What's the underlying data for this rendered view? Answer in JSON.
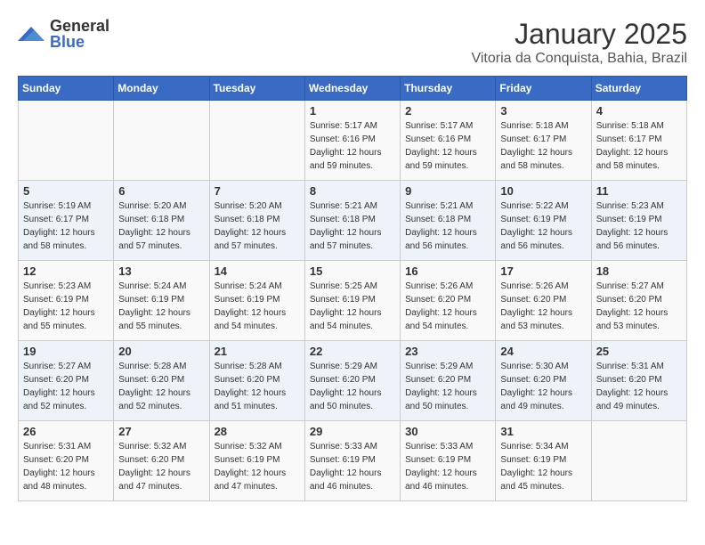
{
  "header": {
    "logo_general": "General",
    "logo_blue": "Blue",
    "title": "January 2025",
    "location": "Vitoria da Conquista, Bahia, Brazil"
  },
  "days_of_week": [
    "Sunday",
    "Monday",
    "Tuesday",
    "Wednesday",
    "Thursday",
    "Friday",
    "Saturday"
  ],
  "weeks": [
    [
      {
        "day": "",
        "info": ""
      },
      {
        "day": "",
        "info": ""
      },
      {
        "day": "",
        "info": ""
      },
      {
        "day": "1",
        "info": "Sunrise: 5:17 AM\nSunset: 6:16 PM\nDaylight: 12 hours\nand 59 minutes."
      },
      {
        "day": "2",
        "info": "Sunrise: 5:17 AM\nSunset: 6:16 PM\nDaylight: 12 hours\nand 59 minutes."
      },
      {
        "day": "3",
        "info": "Sunrise: 5:18 AM\nSunset: 6:17 PM\nDaylight: 12 hours\nand 58 minutes."
      },
      {
        "day": "4",
        "info": "Sunrise: 5:18 AM\nSunset: 6:17 PM\nDaylight: 12 hours\nand 58 minutes."
      }
    ],
    [
      {
        "day": "5",
        "info": "Sunrise: 5:19 AM\nSunset: 6:17 PM\nDaylight: 12 hours\nand 58 minutes."
      },
      {
        "day": "6",
        "info": "Sunrise: 5:20 AM\nSunset: 6:18 PM\nDaylight: 12 hours\nand 57 minutes."
      },
      {
        "day": "7",
        "info": "Sunrise: 5:20 AM\nSunset: 6:18 PM\nDaylight: 12 hours\nand 57 minutes."
      },
      {
        "day": "8",
        "info": "Sunrise: 5:21 AM\nSunset: 6:18 PM\nDaylight: 12 hours\nand 57 minutes."
      },
      {
        "day": "9",
        "info": "Sunrise: 5:21 AM\nSunset: 6:18 PM\nDaylight: 12 hours\nand 56 minutes."
      },
      {
        "day": "10",
        "info": "Sunrise: 5:22 AM\nSunset: 6:19 PM\nDaylight: 12 hours\nand 56 minutes."
      },
      {
        "day": "11",
        "info": "Sunrise: 5:23 AM\nSunset: 6:19 PM\nDaylight: 12 hours\nand 56 minutes."
      }
    ],
    [
      {
        "day": "12",
        "info": "Sunrise: 5:23 AM\nSunset: 6:19 PM\nDaylight: 12 hours\nand 55 minutes."
      },
      {
        "day": "13",
        "info": "Sunrise: 5:24 AM\nSunset: 6:19 PM\nDaylight: 12 hours\nand 55 minutes."
      },
      {
        "day": "14",
        "info": "Sunrise: 5:24 AM\nSunset: 6:19 PM\nDaylight: 12 hours\nand 54 minutes."
      },
      {
        "day": "15",
        "info": "Sunrise: 5:25 AM\nSunset: 6:19 PM\nDaylight: 12 hours\nand 54 minutes."
      },
      {
        "day": "16",
        "info": "Sunrise: 5:26 AM\nSunset: 6:20 PM\nDaylight: 12 hours\nand 54 minutes."
      },
      {
        "day": "17",
        "info": "Sunrise: 5:26 AM\nSunset: 6:20 PM\nDaylight: 12 hours\nand 53 minutes."
      },
      {
        "day": "18",
        "info": "Sunrise: 5:27 AM\nSunset: 6:20 PM\nDaylight: 12 hours\nand 53 minutes."
      }
    ],
    [
      {
        "day": "19",
        "info": "Sunrise: 5:27 AM\nSunset: 6:20 PM\nDaylight: 12 hours\nand 52 minutes."
      },
      {
        "day": "20",
        "info": "Sunrise: 5:28 AM\nSunset: 6:20 PM\nDaylight: 12 hours\nand 52 minutes."
      },
      {
        "day": "21",
        "info": "Sunrise: 5:28 AM\nSunset: 6:20 PM\nDaylight: 12 hours\nand 51 minutes."
      },
      {
        "day": "22",
        "info": "Sunrise: 5:29 AM\nSunset: 6:20 PM\nDaylight: 12 hours\nand 50 minutes."
      },
      {
        "day": "23",
        "info": "Sunrise: 5:29 AM\nSunset: 6:20 PM\nDaylight: 12 hours\nand 50 minutes."
      },
      {
        "day": "24",
        "info": "Sunrise: 5:30 AM\nSunset: 6:20 PM\nDaylight: 12 hours\nand 49 minutes."
      },
      {
        "day": "25",
        "info": "Sunrise: 5:31 AM\nSunset: 6:20 PM\nDaylight: 12 hours\nand 49 minutes."
      }
    ],
    [
      {
        "day": "26",
        "info": "Sunrise: 5:31 AM\nSunset: 6:20 PM\nDaylight: 12 hours\nand 48 minutes."
      },
      {
        "day": "27",
        "info": "Sunrise: 5:32 AM\nSunset: 6:20 PM\nDaylight: 12 hours\nand 47 minutes."
      },
      {
        "day": "28",
        "info": "Sunrise: 5:32 AM\nSunset: 6:19 PM\nDaylight: 12 hours\nand 47 minutes."
      },
      {
        "day": "29",
        "info": "Sunrise: 5:33 AM\nSunset: 6:19 PM\nDaylight: 12 hours\nand 46 minutes."
      },
      {
        "day": "30",
        "info": "Sunrise: 5:33 AM\nSunset: 6:19 PM\nDaylight: 12 hours\nand 46 minutes."
      },
      {
        "day": "31",
        "info": "Sunrise: 5:34 AM\nSunset: 6:19 PM\nDaylight: 12 hours\nand 45 minutes."
      },
      {
        "day": "",
        "info": ""
      }
    ]
  ]
}
